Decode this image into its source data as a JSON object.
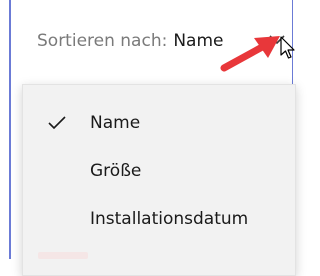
{
  "sort": {
    "label": "Sortieren nach:",
    "selected": "Name"
  },
  "menu": {
    "items": [
      {
        "label": "Name",
        "checked": true
      },
      {
        "label": "Größe",
        "checked": false
      },
      {
        "label": "Installationsdatum",
        "checked": false
      }
    ]
  },
  "colors": {
    "accent": "#6b7bd6",
    "annotation_arrow": "#e8373a",
    "menu_background": "#f2f2f2"
  },
  "icons": [
    "chevron-down-icon",
    "checkmark-icon",
    "mouse-cursor-icon",
    "annotation-arrow-icon"
  ]
}
